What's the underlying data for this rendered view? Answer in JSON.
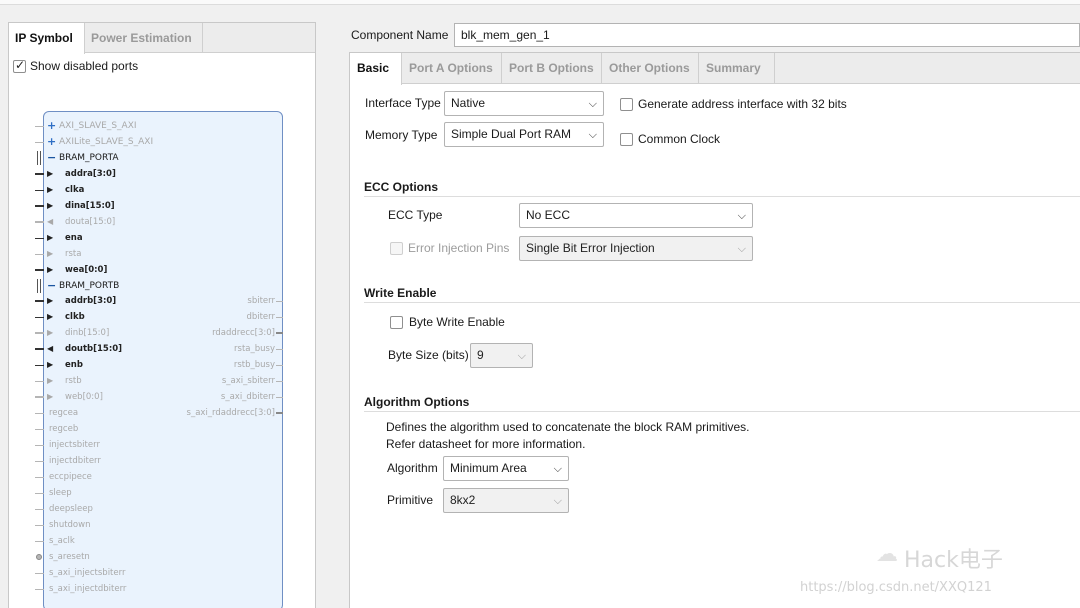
{
  "left": {
    "tabs": [
      "IP Symbol",
      "Power Estimation"
    ],
    "show_disabled_label": "Show disabled ports",
    "left_ports": [
      {
        "label": "AXI_SLAVE_S_AXI",
        "kind": "group",
        "dim": true,
        "sym": "+"
      },
      {
        "label": "AXILite_SLAVE_S_AXI",
        "kind": "group",
        "dim": true,
        "sym": "+"
      },
      {
        "label": "BRAM_PORTA",
        "kind": "group",
        "dim": false,
        "sym": "−"
      },
      {
        "label": "addra[3:0]",
        "kind": "in",
        "dim": false,
        "bus": true
      },
      {
        "label": "clka",
        "kind": "in",
        "dim": false,
        "bus": false
      },
      {
        "label": "dina[15:0]",
        "kind": "in",
        "dim": false,
        "bus": true
      },
      {
        "label": "douta[15:0]",
        "kind": "out",
        "dim": true,
        "bus": true
      },
      {
        "label": "ena",
        "kind": "in",
        "dim": false,
        "bus": false
      },
      {
        "label": "rsta",
        "kind": "in",
        "dim": true,
        "bus": false
      },
      {
        "label": "wea[0:0]",
        "kind": "in",
        "dim": false,
        "bus": true
      },
      {
        "label": "BRAM_PORTB",
        "kind": "group",
        "dim": false,
        "sym": "−"
      },
      {
        "label": "addrb[3:0]",
        "kind": "in",
        "dim": false,
        "bus": true
      },
      {
        "label": "clkb",
        "kind": "in",
        "dim": false,
        "bus": false
      },
      {
        "label": "dinb[15:0]",
        "kind": "in",
        "dim": true,
        "bus": true
      },
      {
        "label": "doutb[15:0]",
        "kind": "out",
        "dim": false,
        "bus": true
      },
      {
        "label": "enb",
        "kind": "in",
        "dim": false,
        "bus": false
      },
      {
        "label": "rstb",
        "kind": "in",
        "dim": true,
        "bus": false
      },
      {
        "label": "web[0:0]",
        "kind": "in",
        "dim": true,
        "bus": true
      },
      {
        "label": "regcea",
        "kind": "plain",
        "dim": true
      },
      {
        "label": "regceb",
        "kind": "plain",
        "dim": true
      },
      {
        "label": "injectsbiterr",
        "kind": "plain",
        "dim": true
      },
      {
        "label": "injectdbiterr",
        "kind": "plain",
        "dim": true
      },
      {
        "label": "eccpipece",
        "kind": "plain",
        "dim": true
      },
      {
        "label": "sleep",
        "kind": "plain",
        "dim": true
      },
      {
        "label": "deepsleep",
        "kind": "plain",
        "dim": true
      },
      {
        "label": "shutdown",
        "kind": "plain",
        "dim": true
      },
      {
        "label": "s_aclk",
        "kind": "plain",
        "dim": true
      },
      {
        "label": "s_aresetn",
        "kind": "dot",
        "dim": true
      },
      {
        "label": "s_axi_injectsbiterr",
        "kind": "plain",
        "dim": true
      },
      {
        "label": "s_axi_injectdbiterr",
        "kind": "plain",
        "dim": true
      }
    ],
    "right_ports": [
      {
        "label": "sbiterr",
        "bus": false
      },
      {
        "label": "dbiterr",
        "bus": false
      },
      {
        "label": "rdaddrecc[3:0]",
        "bus": true
      },
      {
        "label": "rsta_busy",
        "bus": false
      },
      {
        "label": "rstb_busy",
        "bus": false
      },
      {
        "label": "s_axi_sbiterr",
        "bus": false
      },
      {
        "label": "s_axi_dbiterr",
        "bus": false
      },
      {
        "label": "s_axi_rdaddrecc[3:0]",
        "bus": true
      }
    ]
  },
  "right": {
    "component_name_label": "Component Name",
    "component_name_value": "blk_mem_gen_1",
    "tabs": [
      "Basic",
      "Port A Options",
      "Port B Options",
      "Other Options",
      "Summary"
    ],
    "interface_type_label": "Interface Type",
    "interface_type_value": "Native",
    "generate_address_label": "Generate address interface with 32 bits",
    "memory_type_label": "Memory Type",
    "memory_type_value": "Simple Dual Port RAM",
    "common_clock_label": "Common Clock",
    "ecc_section": "ECC Options",
    "ecc_type_label": "ECC Type",
    "ecc_type_value": "No ECC",
    "error_injection_label": "Error Injection Pins",
    "error_injection_value": "Single Bit Error Injection",
    "write_enable_section": "Write Enable",
    "byte_write_label": "Byte Write Enable",
    "byte_size_label": "Byte Size (bits)",
    "byte_size_value": "9",
    "algorithm_section": "Algorithm Options",
    "algo_desc_1": "Defines the algorithm used to concatenate the block RAM primitives.",
    "algo_desc_2": "Refer datasheet for more information.",
    "algorithm_label": "Algorithm",
    "algorithm_value": "Minimum Area",
    "primitive_label": "Primitive",
    "primitive_value": "8kx2"
  },
  "watermark": {
    "brand": "Hack电子",
    "url": "https://blog.csdn.net/XXQ121"
  }
}
